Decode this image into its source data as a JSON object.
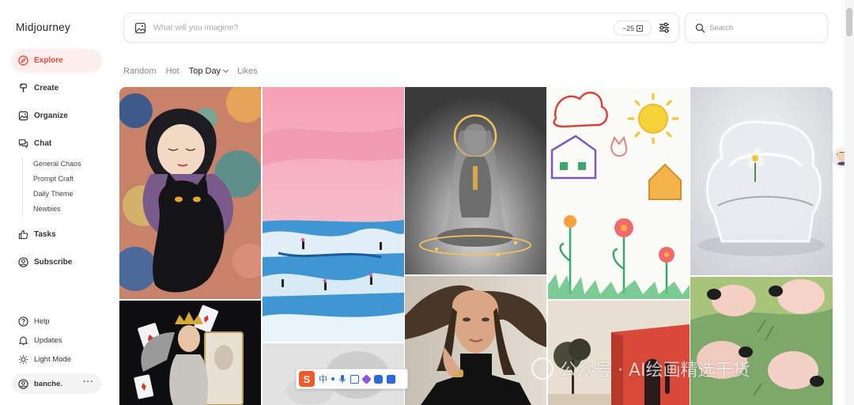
{
  "app": {
    "brand": "Midjourney"
  },
  "sidebar": {
    "items": [
      {
        "label": "Explore",
        "icon": "compass-icon",
        "active": true
      },
      {
        "label": "Create",
        "icon": "brush-icon"
      },
      {
        "label": "Organize",
        "icon": "image-icon"
      },
      {
        "label": "Chat",
        "icon": "chat-icon"
      },
      {
        "label": "Tasks",
        "icon": "thumbs-up-icon"
      },
      {
        "label": "Subscribe",
        "icon": "user-circle-icon"
      }
    ],
    "chat_rooms": [
      "General Chaos",
      "Prompt Craft",
      "Daily Theme",
      "Newbies"
    ],
    "bottom": [
      {
        "label": "Help",
        "icon": "help-icon"
      },
      {
        "label": "Updates",
        "icon": "bell-icon"
      },
      {
        "label": "Light Mode",
        "icon": "sun-icon"
      }
    ],
    "user": {
      "name": "banche.",
      "more": "···"
    }
  },
  "imagine": {
    "placeholder": "What will you imagine?",
    "count": "~25"
  },
  "search": {
    "placeholder": "Search"
  },
  "filters": [
    {
      "label": "Random",
      "active": false
    },
    {
      "label": "Hot",
      "active": false
    },
    {
      "label": "Top Day",
      "active": true
    },
    {
      "label": "Likes",
      "active": false
    }
  ],
  "ime": {
    "logo": "S",
    "lang": "中"
  },
  "watermark": {
    "text": "公众号 · AI绘画精选干货"
  },
  "colors": {
    "accent": "#e8453c",
    "active_bg": "#fdeeee"
  }
}
